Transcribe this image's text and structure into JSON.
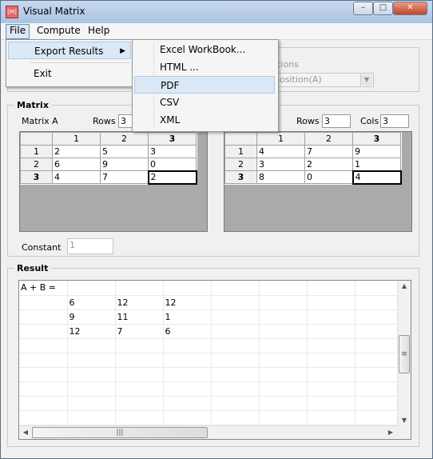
{
  "window": {
    "title": "Visual Matrix"
  },
  "menubar": {
    "file": "File",
    "compute": "Compute",
    "help": "Help"
  },
  "file_menu": {
    "export_results": "Export Results",
    "exit": "Exit"
  },
  "export_submenu": {
    "excel": "Excel WorkBook...",
    "html": "HTML ...",
    "pdf": "PDF",
    "csv": "CSV",
    "xml": "XML"
  },
  "top_group": {
    "partial_label": "tions",
    "combo_value": "position(A)"
  },
  "matrix_group": {
    "title": "Matrix",
    "matrix_a_label": "Matrix A",
    "rows_label": "Rows",
    "rows_a": "3",
    "rows_b": "3",
    "cols_label": "Cols",
    "cols_b": "3",
    "constant_label": "Constant",
    "constant_value": "1"
  },
  "matrix_a": {
    "col_headers": [
      "1",
      "2",
      "3"
    ],
    "row_headers": [
      "1",
      "2",
      "3"
    ],
    "rows": [
      [
        "2",
        "5",
        "3"
      ],
      [
        "6",
        "9",
        "0"
      ],
      [
        "4",
        "7",
        "2"
      ]
    ]
  },
  "matrix_b": {
    "col_headers": [
      "1",
      "2",
      "3"
    ],
    "row_headers": [
      "1",
      "2",
      "3"
    ],
    "rows": [
      [
        "4",
        "7",
        "9"
      ],
      [
        "3",
        "2",
        "1"
      ],
      [
        "8",
        "0",
        "4"
      ]
    ]
  },
  "result_group": {
    "title": "Result",
    "expression": "A + B =",
    "rows": [
      [
        "6",
        "12",
        "12"
      ],
      [
        "9",
        "11",
        "1"
      ],
      [
        "12",
        "7",
        "6"
      ]
    ]
  }
}
